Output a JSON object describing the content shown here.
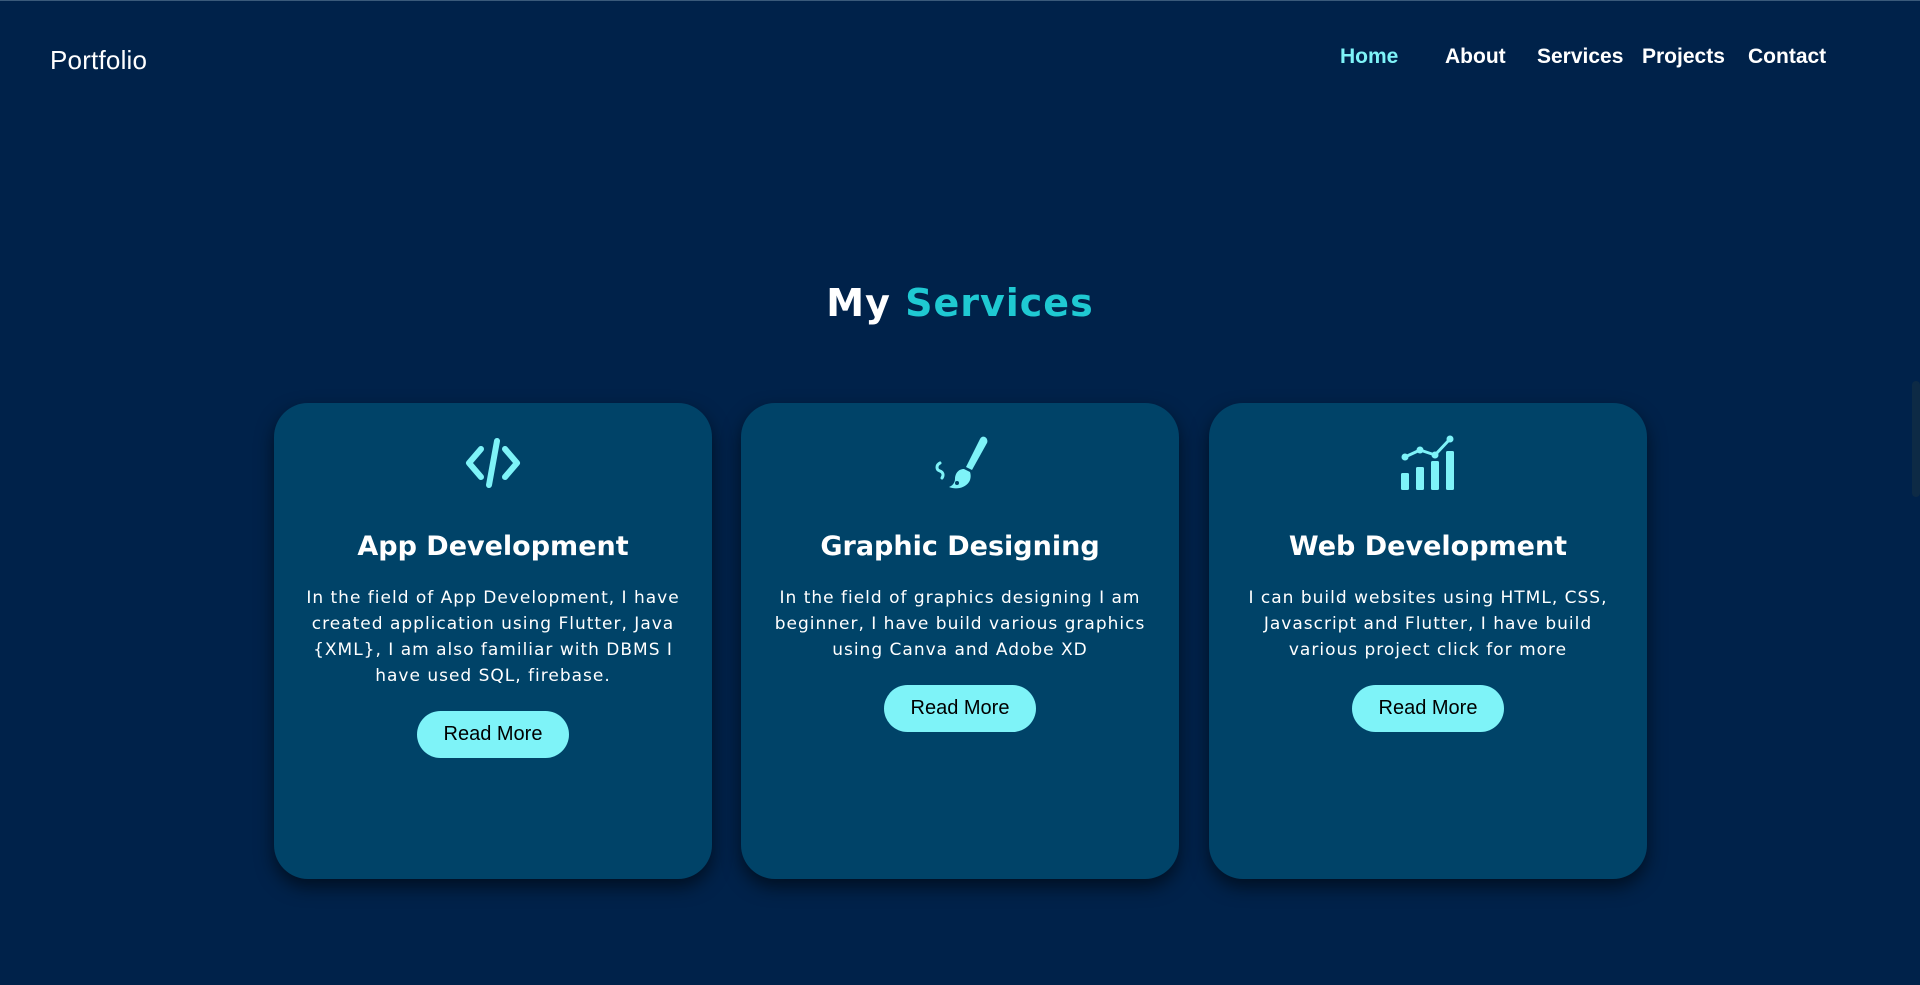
{
  "header": {
    "logo": "Portfolio",
    "nav": [
      {
        "label": "Home",
        "active": true
      },
      {
        "label": "About",
        "active": false
      },
      {
        "label": "Services",
        "active": false
      },
      {
        "label": "Projects",
        "active": false
      },
      {
        "label": "Contact",
        "active": false
      }
    ]
  },
  "services": {
    "title_prefix": "My",
    "title_accent": "Services",
    "cards": [
      {
        "icon": "code-icon",
        "title": "App Development",
        "text": "In the field of App Development, I have created application using Flutter, Java {XML}, I am also familiar with DBMS I have used SQL, firebase.",
        "button": "Read More"
      },
      {
        "icon": "paintbrush-icon",
        "title": "Graphic Designing",
        "text": "In the field of graphics designing I am beginner, I have build various graphics using Canva and Adobe XD",
        "button": "Read More"
      },
      {
        "icon": "chart-icon",
        "title": "Web Development",
        "text": "I can build websites using HTML, CSS, Javascript and Flutter, I have build various project click for more",
        "button": "Read More"
      }
    ]
  },
  "colors": {
    "background": "#00224a",
    "card": "#004368",
    "accent": "#7ef3f8",
    "title_accent": "#1fc9d2"
  }
}
